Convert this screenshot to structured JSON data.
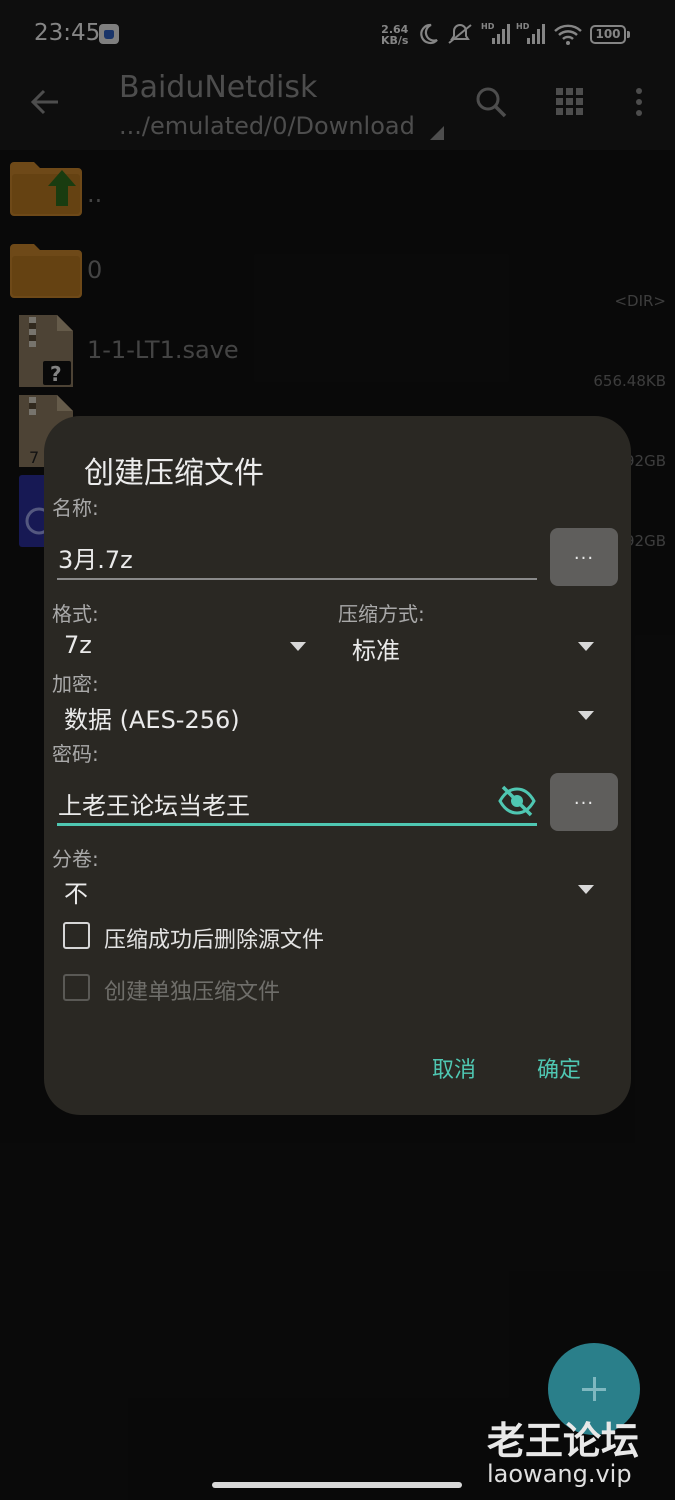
{
  "statusbar": {
    "time": "23:45",
    "speed_value": "2.64",
    "speed_unit": "KB/s",
    "battery": "100"
  },
  "appbar": {
    "title": "BaiduNetdisk",
    "path": ".../emulated/0/Download"
  },
  "files": [
    {
      "name": "..",
      "meta": "",
      "icon": "folder-up-icon"
    },
    {
      "name": "0",
      "meta": "<DIR>",
      "icon": "folder-icon"
    },
    {
      "name": "1-1-LT1.save",
      "meta": "656.48KB",
      "icon": "unknown-file-icon"
    },
    {
      "name": "",
      "meta": "92GB",
      "icon": "archive-7z-icon"
    },
    {
      "name": "",
      "meta": "92GB",
      "icon": "app-file-icon"
    }
  ],
  "dialog": {
    "title": "创建压缩文件",
    "name_label": "名称:",
    "name_value": "3月.7z",
    "more_label": "...",
    "format_label": "格式:",
    "format_value": "7z",
    "method_label": "压缩方式:",
    "method_value": "标准",
    "encrypt_label": "加密:",
    "encrypt_value": "数据 (AES-256)",
    "password_label": "密码:",
    "password_value": "上老王论坛当老王",
    "split_label": "分卷:",
    "split_value": "不",
    "delete_source_label": "压缩成功后删除源文件",
    "separate_label": "创建单独压缩文件",
    "cancel_label": "取消",
    "ok_label": "确定"
  },
  "watermark": {
    "main": "老王论坛",
    "sub": "laowang.vip"
  },
  "colors": {
    "accent": "#4fc7b2",
    "dialog_bg": "#2a2823",
    "folder": "#c9862d",
    "fab": "#2a7f8a"
  }
}
